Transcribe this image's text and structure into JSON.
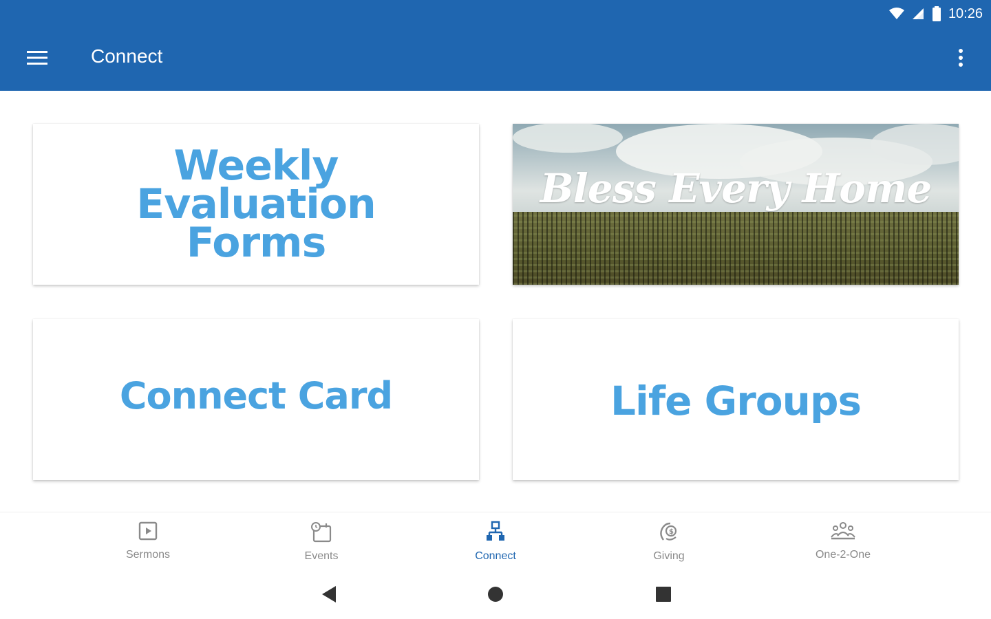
{
  "status_bar": {
    "time": "10:26",
    "icons": [
      "wifi-icon",
      "signal-icon",
      "battery-icon"
    ]
  },
  "app_bar": {
    "title": "Connect",
    "menu_icon": "hamburger-menu-icon",
    "overflow_icon": "more-vert-icon",
    "color": "#1f66b0"
  },
  "cards": {
    "weekly": {
      "lines": [
        "Weekly",
        "Evaluation",
        "Forms"
      ]
    },
    "bless": {
      "title": "Bless Every Home"
    },
    "connect_card": {
      "title": "Connect Card"
    },
    "life_groups": {
      "title": "Life Groups"
    },
    "text_color": "#4aa3e0"
  },
  "bottom_nav": {
    "items": [
      {
        "label": "Sermons",
        "icon": "play-box-icon",
        "active": false
      },
      {
        "label": "Events",
        "icon": "calendar-clock-icon",
        "active": false
      },
      {
        "label": "Connect",
        "icon": "connect-network-icon",
        "active": true
      },
      {
        "label": "Giving",
        "icon": "giving-hand-icon",
        "active": false
      },
      {
        "label": "One-2-One",
        "icon": "people-group-icon",
        "active": false
      }
    ],
    "active_color": "#1f66b0",
    "inactive_color": "#8a8a8a"
  },
  "system_nav": {
    "icons": [
      "back-triangle-icon",
      "home-circle-icon",
      "recents-square-icon"
    ]
  }
}
